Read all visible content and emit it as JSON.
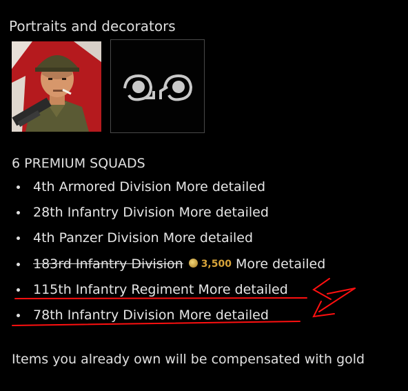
{
  "section_title": "Portraits and decorators",
  "squads_title": "6 PREMIUM SQUADS",
  "more_label": "More detailed",
  "squads": [
    {
      "name": "4th Armored Division"
    },
    {
      "name": "28th Infantry Division"
    },
    {
      "name": "4th Panzer Division"
    },
    {
      "name": "183rd Infantry Division",
      "owned": true,
      "price": "3,500"
    },
    {
      "name": "115th Infantry Regiment"
    },
    {
      "name": "78th Infantry Division"
    }
  ],
  "footer_note": "Items you already own will be compensated with gold",
  "colors": {
    "background": "#000000",
    "text": "#e0e0e0",
    "gold": "#d8a43a",
    "annotation": "#ff0000",
    "decorator_border": "#4a4a4a"
  },
  "icons": [
    "soldier-portrait",
    "decorator-flower-icon",
    "coin-icon"
  ]
}
